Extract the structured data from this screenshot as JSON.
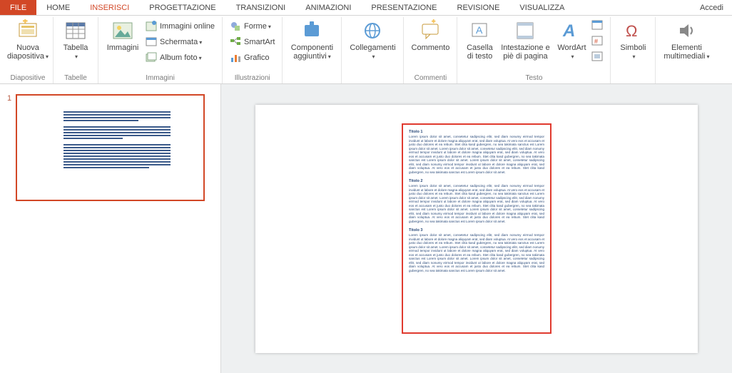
{
  "tabs": {
    "file": "FILE",
    "home": "HOME",
    "insert": "INSERISCI",
    "design": "PROGETTAZIONE",
    "transitions": "TRANSIZIONI",
    "animations": "ANIMAZIONI",
    "slideshow": "PRESENTAZIONE",
    "review": "REVISIONE",
    "view": "VISUALIZZA"
  },
  "accedi": "Accedi",
  "ribbon": {
    "slides": {
      "newSlide": "Nuova diapositiva",
      "group": "Diapositive"
    },
    "tables": {
      "table": "Tabella",
      "group": "Tabelle"
    },
    "images": {
      "images": "Immagini",
      "online": "Immagini online",
      "screenshot": "Schermata",
      "album": "Album foto",
      "group": "Immagini"
    },
    "illustr": {
      "shapes": "Forme",
      "smartart": "SmartArt",
      "chart": "Grafico",
      "group": "Illustrazioni"
    },
    "addins": {
      "addins": "Componenti aggiuntivi",
      "group": ""
    },
    "links": {
      "links": "Collegamenti",
      "group": ""
    },
    "comments": {
      "comment": "Commento",
      "group": "Commenti"
    },
    "text": {
      "textbox": "Casella di testo",
      "headerfooter": "Intestazione e piè di pagina",
      "wordart": "WordArt",
      "group": "Testo"
    },
    "symbols": {
      "symbols": "Simboli",
      "group": ""
    },
    "media": {
      "media": "Elementi multimediali",
      "group": ""
    },
    "textExtraIcons": {
      "date": "date-time-icon",
      "slidenum": "slide-number-icon",
      "object": "insert-object-icon"
    }
  },
  "thumbnail": {
    "number": "1"
  },
  "document": {
    "sections": [
      {
        "title": "Titolo 1",
        "body": "Lorem ipsum dolor sit amet, consetetur sadipscing elitr, sed diam nonumy eirmod tempor invidunt ut labore et dolore magna aliquyam erat, sed diam voluptua. At vero eos et accusam et justo duo dolores et ea rebum. Stet clita kasd gubergren, no sea takimata sanctus est Lorem ipsum dolor sit amet. Lorem ipsum dolor sit amet, consetetur sadipscing elitr, sed diam nonumy eirmod tempor invidunt ut labore et dolore magna aliquyam erat, sed diam voluptua. At vero eos et accusam et justo duo dolores et ea rebum. Stet clita kasd gubergren, no sea takimata sanctus est Lorem ipsum dolor sit amet. Lorem ipsum dolor sit amet, consetetur sadipscing elitr, sed diam nonumy eirmod tempor invidunt ut labore et dolore magna aliquyam erat, sed diam voluptua. At vero eos et accusam et justo duo dolores et ea rebum. Stet clita kasd gubergren, no sea takimata sanctus est Lorem ipsum dolor sit amet."
      },
      {
        "title": "Titolo 2",
        "body": "Lorem ipsum dolor sit amet, consetetur sadipscing elitr, sed diam nonumy eirmod tempor invidunt ut labore et dolore magna aliquyam erat, sed diam voluptua. At vero eos et accusam et justo duo dolores et ea rebum. Stet clita kasd gubergren, no sea takimata sanctus est Lorem ipsum dolor sit amet. Lorem ipsum dolor sit amet, consetetur sadipscing elitr, sed diam nonumy eirmod tempor invidunt ut labore et dolore magna aliquyam erat, sed diam voluptua. At vero eos et accusam et justo duo dolores et ea rebum. Stet clita kasd gubergren, no sea takimata sanctus est Lorem ipsum dolor sit amet. Lorem ipsum dolor sit amet, consetetur sadipscing elitr, sed diam nonumy eirmod tempor invidunt ut labore et dolore magna aliquyam erat, sed diam voluptua. At vero eos et accusam et justo duo dolores et ea rebum. Stet clita kasd gubergren, no sea takimata sanctus est Lorem ipsum dolor sit amet."
      },
      {
        "title": "Titolo 3",
        "body": "Lorem ipsum dolor sit amet, consetetur sadipscing elitr, sed diam nonumy eirmod tempor invidunt ut labore et dolore magna aliquyam erat, sed diam voluptua. At vero eos et accusam et justo duo dolores et ea rebum. Stet clita kasd gubergren, no sea takimata sanctus est Lorem ipsum dolor sit amet. Lorem ipsum dolor sit amet, consetetur sadipscing elitr, sed diam nonumy eirmod tempor invidunt ut labore et dolore magna aliquyam erat, sed diam voluptua. At vero eos et accusam et justo duo dolores et ea rebum. Stet clita kasd gubergren, no sea takimata sanctus est Lorem ipsum dolor sit amet. Lorem ipsum dolor sit amet, consetetur sadipscing elitr, sed diam nonumy eirmod tempor invidunt ut labore et dolore magna aliquyam erat, sed diam voluptua. At vero eos et accusam et justo duo dolores et ea rebum. Stet clita kasd gubergren, no sea takimata sanctus est Lorem ipsum dolor sit amet."
      }
    ]
  }
}
